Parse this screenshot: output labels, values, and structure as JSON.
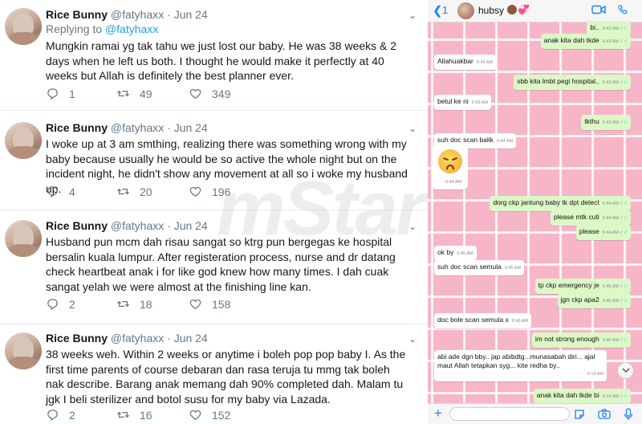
{
  "tweets": [
    {
      "name": "Rice Bunny",
      "handle": "@fatyhaxx",
      "dot": "·",
      "date": "Jun 24",
      "replying_prefix": "Replying to",
      "replying_to": "@fatyhaxx",
      "text": "Mungkin ramai yg tak tahu we just lost our baby. He was 38 weeks & 2 days when he left us both. I thought he would make it perfectly at 40 weeks but Allah is definitely the best planner ever.",
      "replies": "1",
      "retweets": "49",
      "likes": "349"
    },
    {
      "name": "Rice Bunny",
      "handle": "@fatyhaxx",
      "dot": "·",
      "date": "Jun 24",
      "text": "I woke up at 3 am smthing, realizing there was something wrong with my baby because usually he would be so active the whole night but on the incident night, he didn't show any movement at all so i woke my husband up.",
      "replies": "4",
      "retweets": "20",
      "likes": "196"
    },
    {
      "name": "Rice Bunny",
      "handle": "@fatyhaxx",
      "dot": "·",
      "date": "Jun 24",
      "text": "Husband pun mcm dah risau sangat so ktrg pun bergegas ke hospital bersalin kuala lumpur. After registeration process, nurse and dr datang check heartbeat anak i for like god knew how many times. I dah cuak sangat yelah we were almost at the finishing line kan.",
      "replies": "2",
      "retweets": "18",
      "likes": "158"
    },
    {
      "name": "Rice Bunny",
      "handle": "@fatyhaxx",
      "dot": "·",
      "date": "Jun 24",
      "text": "38 weeks weh. Within 2 weeks or anytime i boleh pop pop baby I. As the first time parents of course debaran dan rasa teruja tu mmg tak boleh nak describe. Barang anak memang dah 90% completed dah. Malam tu jgk I beli sterilizer and botol susu for my baby via Lazada.",
      "replies": "2",
      "retweets": "16",
      "likes": "152"
    }
  ],
  "chat": {
    "back_count": "1",
    "contact_name": "hubsy",
    "messages": [
      {
        "text": "bi..",
        "time": "6:43 AM",
        "dir": "out"
      },
      {
        "text": "anak kita dah tkde",
        "time": "6:43 AM",
        "dir": "out"
      },
      {
        "text": "Allahuakbar",
        "time": "6:43 AM",
        "dir": "in"
      },
      {
        "text": "sbb kita lmbt pegi hospital..",
        "time": "6:43 AM",
        "dir": "out"
      },
      {
        "text": "betul ke ni",
        "time": "6:43 AM",
        "dir": "in"
      },
      {
        "text": "tkthu",
        "time": "6:43 AM",
        "dir": "out"
      },
      {
        "text": "suh doc scan balik",
        "time": "6:44 AM",
        "dir": "in"
      },
      {
        "emoji": "persevering-face",
        "time": "6:44 AM",
        "dir": "in"
      },
      {
        "text": "dorg ckp jantung baby tk dpt detect",
        "time": "6:44 AM",
        "dir": "out"
      },
      {
        "text": "please mtk cuti",
        "time": "6:44 AM",
        "dir": "out"
      },
      {
        "text": "please",
        "time": "6:44 AM",
        "dir": "out"
      },
      {
        "text": "ok by",
        "time": "6:45 AM",
        "dir": "in"
      },
      {
        "text": "suh doc scan semula",
        "time": "6:45 AM",
        "dir": "in"
      },
      {
        "text": "tp ckp emergency je",
        "time": "6:45 AM",
        "dir": "out"
      },
      {
        "text": "jgn ckp apa2",
        "time": "6:45 AM",
        "dir": "out"
      },
      {
        "text": "doc bole scan semula x",
        "time": "6:46 AM",
        "dir": "in"
      },
      {
        "text": "im not strong enough",
        "time": "6:46 AM",
        "dir": "out"
      },
      {
        "text": "abi ade dgn bby.. jap abibdtg...munasabah diri... ajal maut Allah tetapkan syg... kite redha by..",
        "time": "6:19 AM",
        "dir": "in"
      },
      {
        "text": "anak kita dah tkde bi",
        "time": "6:19 AM",
        "dir": "out"
      }
    ],
    "ticks": "✓✓",
    "input_placeholder": ""
  },
  "watermark": "mStar",
  "colors": {
    "twitter_link": "#1da1f2",
    "twitter_meta": "#657786",
    "chat_bg_pink": "#f7b6c8",
    "bubble_out": "#dcf8c6",
    "bubble_in": "#ffffff",
    "ios_blue": "#1a7ef7"
  }
}
